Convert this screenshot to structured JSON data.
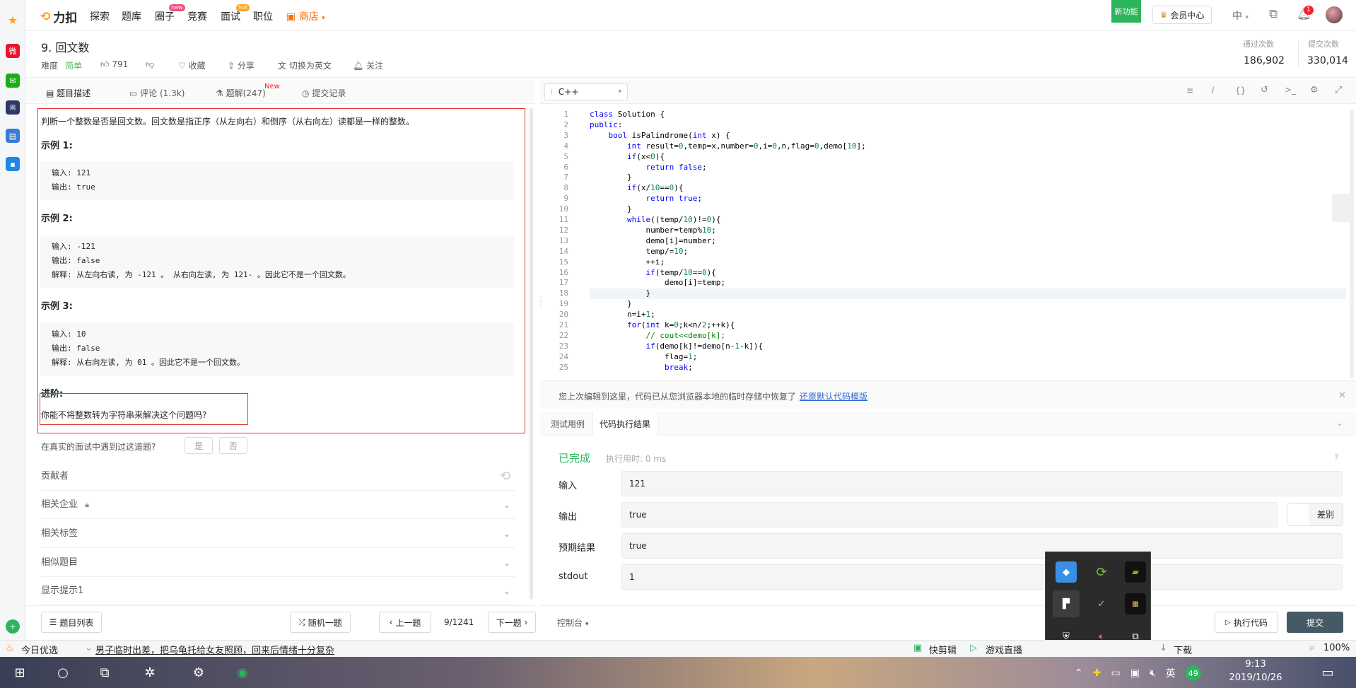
{
  "nav": {
    "logo_text": "力扣",
    "items": [
      "探索",
      "题库",
      "圈子",
      "竞赛",
      "面试",
      "职位",
      "商店"
    ],
    "badge_new": "new",
    "badge_hot": "hot",
    "new_feature": "新功能",
    "vip": "会员中心",
    "lang": "中",
    "notif_count": "1"
  },
  "problem": {
    "title": "9. 回文数",
    "difficulty_label": "难度",
    "difficulty": "简单",
    "likes": "791",
    "favorite": "收藏",
    "share": "分享",
    "switch_en": "切换为英文",
    "follow": "关注",
    "pass_label": "通过次数",
    "pass_count": "186,902",
    "submit_label": "提交次数",
    "submit_count": "330,014"
  },
  "tabs": {
    "desc": "题目描述",
    "comments": "评论 (1.3k)",
    "solutions": "题解(247)",
    "solutions_new": "New",
    "records": "提交记录"
  },
  "description": {
    "intro": "判断一个整数是否是回文数。回文数是指正序（从左向右）和倒序（从右向左）读都是一样的整数。",
    "ex1_title": "示例 1:",
    "ex1": [
      "输入: 121",
      "输出: true"
    ],
    "ex2_title": "示例 2:",
    "ex2": [
      "输入: -121",
      "输出: false",
      "解释: 从左向右读, 为 -121 。 从右向左读, 为 121- 。因此它不是一个回文数。"
    ],
    "ex3_title": "示例 3:",
    "ex3": [
      "输入: 10",
      "输出: false",
      "解释: 从右向左读, 为 01 。因此它不是一个回文数。"
    ],
    "advanced_title": "进阶:",
    "advanced": "你能不将整数转为字符串来解决这个问题吗?",
    "interview_q": "在真实的面试中遇到过这道题?",
    "yes": "是",
    "no": "否"
  },
  "accordion": [
    "贡献者",
    "相关企业",
    "相关标签",
    "相似题目",
    "显示提示1"
  ],
  "bottom_left": {
    "list": "题目列表",
    "random": "随机一题",
    "prev": "上一题",
    "page": "9/1241",
    "next": "下一题"
  },
  "editor": {
    "language": "C++",
    "lines": [
      "class Solution {",
      "public:",
      "    bool isPalindrome(int x) {",
      "        int result=0,temp=x,number=0,i=0,n,flag=0,demo[10];",
      "        if(x<0){",
      "            return false;",
      "        }",
      "        if(x/10==0){",
      "            return true;",
      "        }",
      "        while((temp/10)!=0){",
      "            number=temp%10;",
      "            demo[i]=number;",
      "            temp/=10;",
      "            ++i;",
      "            if(temp/10==0){",
      "                demo[i]=temp;",
      "            }",
      "        }",
      "        n=i+1;",
      "        for(int k=0;k<n/2;++k){",
      "            // cout<<demo[k];",
      "            if(demo[k]!=demo[n-1-k]){",
      "                flag=1;",
      "                break;"
    ],
    "restore_msg": "您上次编辑到这里，代码已从您浏览器本地的临时存储中恢复了",
    "restore_link": "还原默认代码模版"
  },
  "result": {
    "tab_test": "测试用例",
    "tab_result": "代码执行结果",
    "status": "已完成",
    "time": "执行用时: 0 ms",
    "input_label": "输入",
    "input": "121",
    "output_label": "输出",
    "output": "true",
    "diff": "差别",
    "expected_label": "预期结果",
    "expected": "true",
    "stdout_label": "stdout",
    "stdout": "1",
    "console": "控制台",
    "run": "执行代码",
    "submit": "提交"
  },
  "strip": {
    "today": "今日优选",
    "headline": "男子临时出差，把乌龟托给女友照顾，回来后情绪十分复杂",
    "kuaijian": "快剪辑",
    "game": "游戏直播",
    "download": "下载",
    "zoom": "100%"
  },
  "taskbar": {
    "time": "9:13",
    "date": "2019/10/26",
    "ime": "英",
    "score": "49"
  },
  "colors": {
    "accent": "#2db55d",
    "warn": "#ffa116",
    "red_box": "#e53935",
    "submit_bg": "#455a64"
  }
}
